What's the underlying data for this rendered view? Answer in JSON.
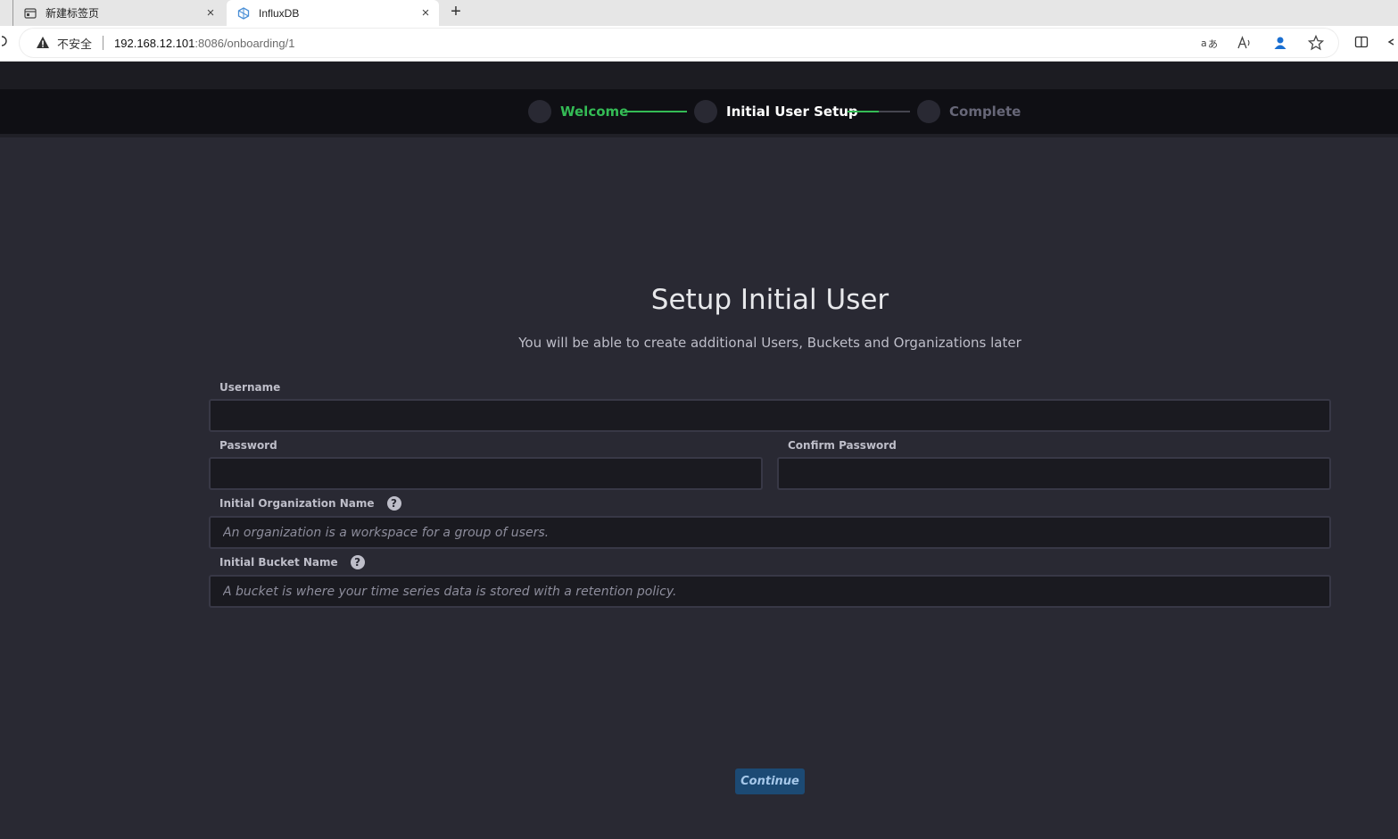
{
  "browser": {
    "tabs": [
      {
        "title": "新建标签页",
        "icon": "newtab-page-icon",
        "active": false
      },
      {
        "title": "InfluxDB",
        "icon": "influxdb-logo-icon",
        "active": true
      }
    ],
    "new_tab_label": "+",
    "close_glyph": "×",
    "address": {
      "security_label": "不安全",
      "url_host": "192.168.12.101",
      "url_rest": ":8086/onboarding/1"
    }
  },
  "stepper": {
    "steps": [
      {
        "label": "Welcome",
        "state": "done"
      },
      {
        "label": "Initial User Setup",
        "state": "current"
      },
      {
        "label": "Complete",
        "state": "pending"
      }
    ]
  },
  "form": {
    "title": "Setup Initial User",
    "subtitle": "You will be able to create additional Users, Buckets and Organizations later",
    "username": {
      "label": "Username",
      "value": "",
      "placeholder": ""
    },
    "password": {
      "label": "Password",
      "value": "",
      "placeholder": ""
    },
    "confirm_password": {
      "label": "Confirm Password",
      "value": "",
      "placeholder": ""
    },
    "org_name": {
      "label": "Initial Organization Name",
      "value": "",
      "placeholder": "An organization is a workspace for a group of users."
    },
    "bucket_name": {
      "label": "Initial Bucket Name",
      "value": "",
      "placeholder": "A bucket is where your time series data is stored with a retention policy."
    },
    "help_glyph": "?",
    "continue_label": "Continue"
  },
  "colors": {
    "background": "#292933",
    "stepper_bg": "#0f0f14",
    "success_green": "#34bb55",
    "button_blue": "#1c4a74",
    "input_bg": "#1a1a20"
  }
}
